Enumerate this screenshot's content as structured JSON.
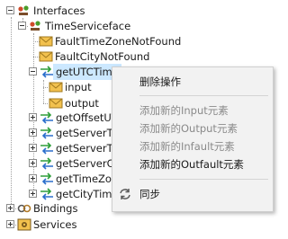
{
  "tree": {
    "interfaces": "Interfaces",
    "time_service": "TimeServiceface",
    "fault_tz": "FaultTimeZoneNotFound",
    "fault_city": "FaultCityNotFound",
    "get_utc": "getUTCTime",
    "input": "input",
    "output": "output",
    "get_offset": "getOffsetUT",
    "get_server1": "getServerTin",
    "get_server2": "getServerTin",
    "get_server_city": "getServerCit",
    "get_timezone": "getTimeZon",
    "get_city_time": "getCityTime",
    "bindings": "Bindings",
    "services": "Services"
  },
  "menu": {
    "delete": "删除操作",
    "add_input": "添加新的Input元素",
    "add_output": "添加新的Output元素",
    "add_infault": "添加新的Infault元素",
    "add_outfault": "添加新的Outfault元素",
    "sync": "同步"
  },
  "colors": {
    "selection": "#cce8ff",
    "menu_bg": "#f2f2f2",
    "envelope": "#f2c14e",
    "op_green": "#2e9e3a",
    "op_blue": "#2b6fcc"
  }
}
